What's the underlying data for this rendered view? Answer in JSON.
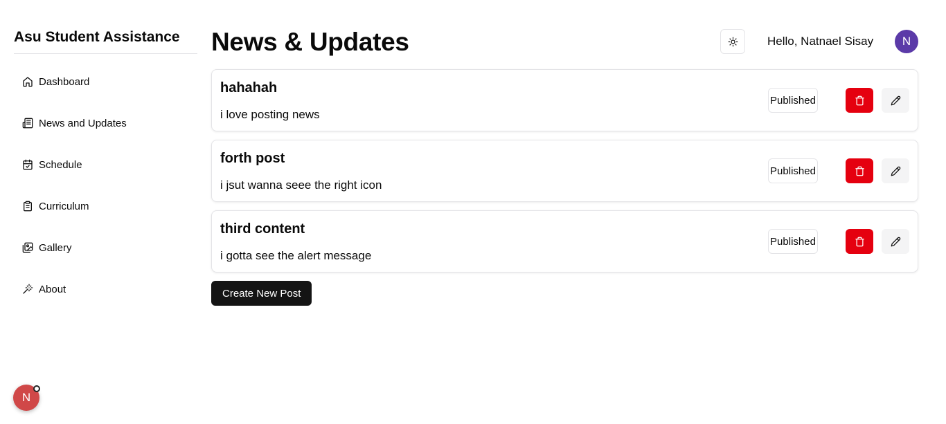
{
  "sidebar": {
    "title": "Asu Student Assistance",
    "items": [
      {
        "label": "Dashboard",
        "icon": "home-icon"
      },
      {
        "label": "News and Updates",
        "icon": "newspaper-icon"
      },
      {
        "label": "Schedule",
        "icon": "calendar-check-icon"
      },
      {
        "label": "Curriculum",
        "icon": "clipboard-list-icon"
      },
      {
        "label": "Gallery",
        "icon": "images-icon"
      },
      {
        "label": "About",
        "icon": "wand-icon"
      }
    ]
  },
  "header": {
    "title": "News & Updates",
    "theme_icon": "sun-icon",
    "greeting": "Hello, Natnael Sisay",
    "avatar_initial": "N"
  },
  "posts": [
    {
      "title": "hahahah",
      "body": "i love posting news",
      "status": "Published"
    },
    {
      "title": "forth post",
      "body": "i jsut wanna seee the right icon",
      "status": "Published"
    },
    {
      "title": "third content",
      "body": "i gotta see the alert message",
      "status": "Published"
    }
  ],
  "create_button": "Create New Post",
  "dev_badge": {
    "initial": "N"
  },
  "colors": {
    "delete": "#e5000f",
    "primary": "#141414",
    "avatar": "#5b3aa8",
    "dev_badge": "#d04848"
  }
}
